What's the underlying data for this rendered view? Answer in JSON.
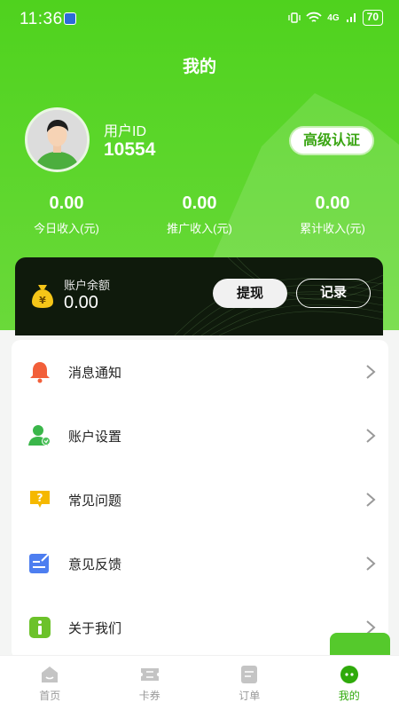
{
  "status_bar": {
    "time": "11:36",
    "battery": "70",
    "network": "4G"
  },
  "page_title": "我的",
  "profile": {
    "id_label": "用户ID",
    "id_value": "10554",
    "verify_button": "高级认证"
  },
  "stats": [
    {
      "value": "0.00",
      "label": "今日收入(元)"
    },
    {
      "value": "0.00",
      "label": "推广收入(元)"
    },
    {
      "value": "0.00",
      "label": "累计收入(元)"
    }
  ],
  "balance": {
    "label": "账户余额",
    "value": "0.00",
    "withdraw_button": "提现",
    "record_button": "记录"
  },
  "menu": [
    {
      "label": "消息通知",
      "icon": "bell-icon"
    },
    {
      "label": "账户设置",
      "icon": "user-settings-icon"
    },
    {
      "label": "常见问题",
      "icon": "question-icon"
    },
    {
      "label": "意见反馈",
      "icon": "feedback-icon"
    },
    {
      "label": "关于我们",
      "icon": "info-icon"
    }
  ],
  "tabs": [
    {
      "label": "首页",
      "icon": "home-icon"
    },
    {
      "label": "卡券",
      "icon": "coupon-icon"
    },
    {
      "label": "订单",
      "icon": "order-icon"
    },
    {
      "label": "我的",
      "icon": "profile-icon"
    }
  ],
  "colors": {
    "brand": "#52d11f",
    "accent_text": "#2faa0b",
    "card_dark": "#0f1a0c"
  }
}
